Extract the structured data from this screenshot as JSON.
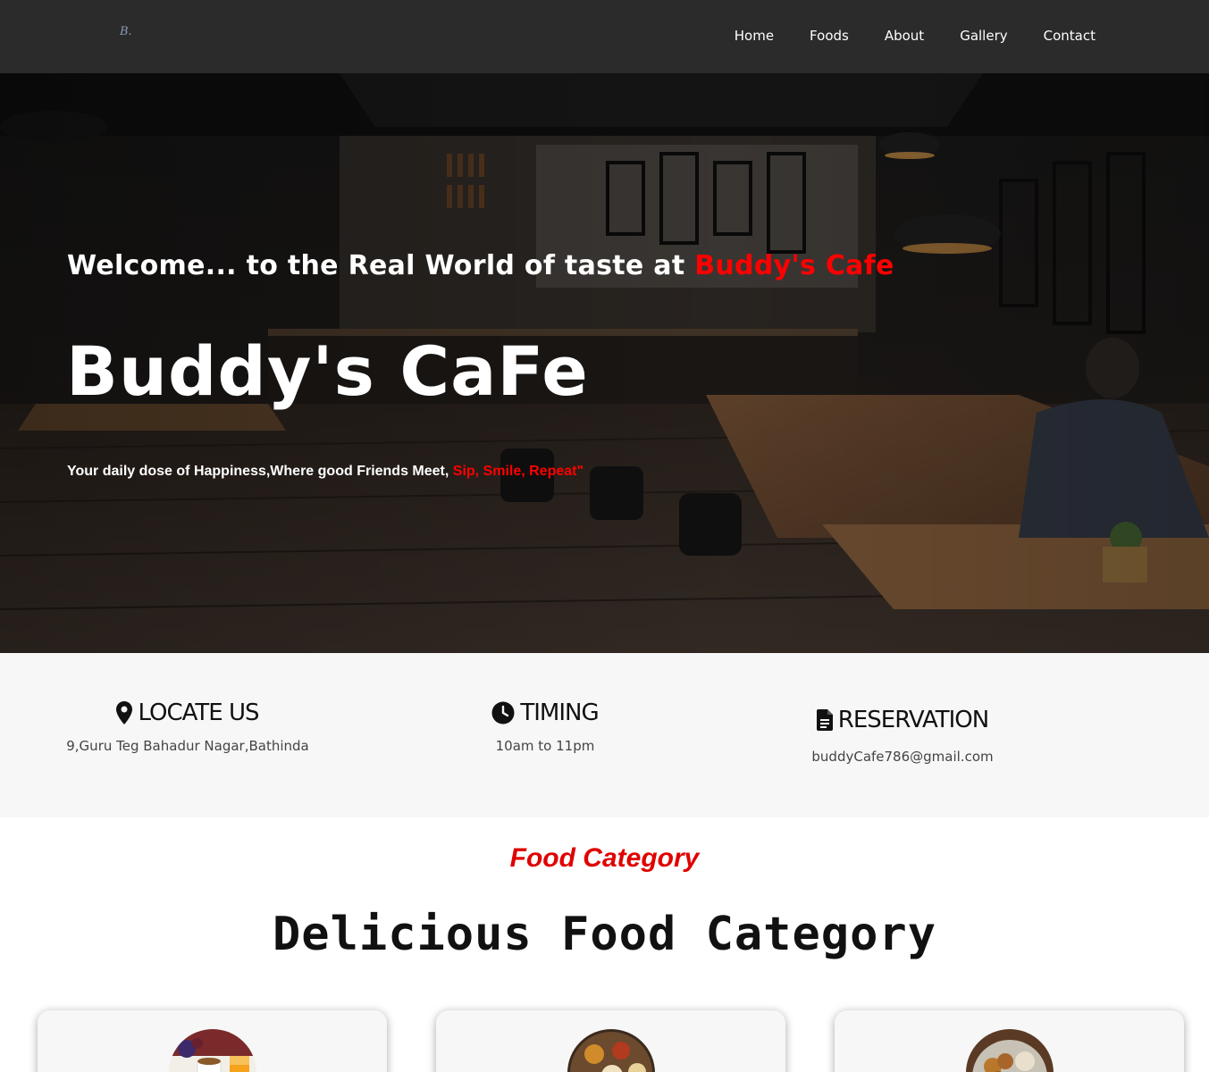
{
  "nav": {
    "logo": "B.",
    "links": [
      "Home",
      "Foods",
      "About",
      "Gallery",
      "Contact"
    ]
  },
  "hero": {
    "welcome_prefix": "Welcome... to the Real World of taste at ",
    "welcome_accent": "Buddy's Cafe",
    "title": "Buddy's CaFe",
    "tagline_prefix": "Your daily dose of Happiness,Where good Friends Meet, ",
    "tagline_accent": "Sip, Smile, Repeat\""
  },
  "info": {
    "locate": {
      "heading": "LOCATE US",
      "text": "9,Guru Teg Bahadur Nagar,Bathinda",
      "icon": "map-pin-icon"
    },
    "timing": {
      "heading": "TIMING",
      "text": "10am to 11pm",
      "icon": "clock-icon"
    },
    "reservation": {
      "heading": "RESERVATION",
      "text": "buddyCafe786@gmail.com",
      "icon": "document-icon"
    }
  },
  "food_category": {
    "tag": "Food Category",
    "title": "Delicious Food Category"
  },
  "colors": {
    "accent": "#ff0000",
    "nav_bg": "#2b2b2b",
    "info_bg": "#f7f7f7"
  }
}
